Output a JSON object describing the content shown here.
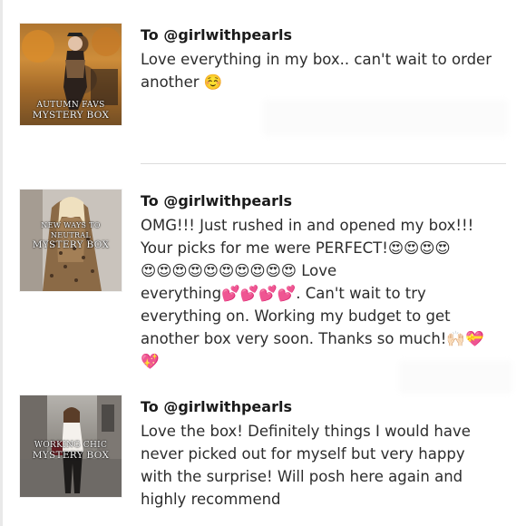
{
  "reviews": [
    {
      "recipient": "To @girlwithpearls",
      "text": "Love everything in my box.. can't wait to order\nanother ☺️",
      "thumbnail": {
        "caption_line1": "AUTUMN FAVS",
        "caption_line2": "MYSTERY BOX"
      }
    },
    {
      "recipient": "To @girlwithpearls",
      "text": "OMG!!! Just rushed in and opened my box!!!\nYour picks for me were PERFECT!😍😍😍😍\n😍😍😍😍😍😍😍😍😍😍 Love\neverything💕💕💕💕. Can't wait to try\neverything on. Working my budget to get\nanother box very soon. Thanks so much!🙌🏻💝\n💖",
      "thumbnail": {
        "caption_line1": "NEW WAYS TO NEUTRAL",
        "caption_line2": "MYSTERY BOX"
      }
    },
    {
      "recipient": "To @girlwithpearls",
      "text": "Love the box! Definitely things I would have\nnever picked out for myself but very happy\nwith the surprise! Will posh here again and\nhighly recommend",
      "thumbnail": {
        "caption_line1": "WORKING CHIC",
        "caption_line2": "MYSTERY BOX"
      }
    }
  ]
}
